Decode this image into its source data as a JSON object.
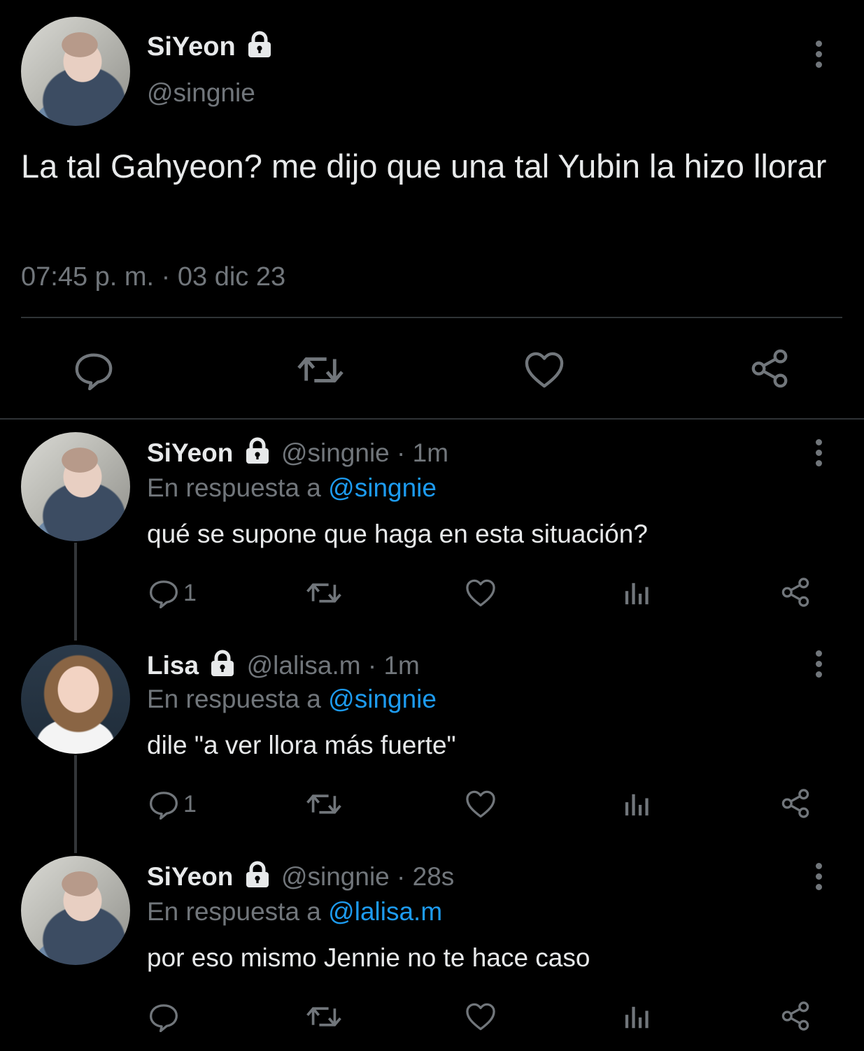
{
  "main_tweet": {
    "name": "SiYeon",
    "handle": "@singnie",
    "text": "La tal Gahyeon? me dijo que una tal Yubin la hizo llorar",
    "timestamp": "07:45 p. m. · 03 dic 23"
  },
  "replies": [
    {
      "name": "SiYeon",
      "handle": "@singnie",
      "time": "· 1m",
      "reply_prefix": "En respuesta a",
      "reply_to": "@singnie",
      "text": "qué se supone que haga en esta situación?",
      "reply_count": "1"
    },
    {
      "name": "Lisa",
      "handle": "@lalisa.m",
      "time": "· 1m",
      "reply_prefix": "En respuesta a",
      "reply_to": "@singnie",
      "text": "dile \"a ver llora más fuerte\"",
      "reply_count": "1"
    },
    {
      "name": "SiYeon",
      "handle": "@singnie",
      "time": "· 28s",
      "reply_prefix": "En respuesta a",
      "reply_to": "@lalisa.m",
      "text": "por eso mismo Jennie no te hace caso",
      "reply_count": ""
    }
  ],
  "icons": [
    "lock-icon",
    "more-icon",
    "reply-icon",
    "retweet-icon",
    "like-icon",
    "views-icon",
    "share-icon"
  ],
  "colors": {
    "background": "#000000",
    "text": "#e7e9ea",
    "muted": "#71767b",
    "link": "#1d9bf0"
  }
}
